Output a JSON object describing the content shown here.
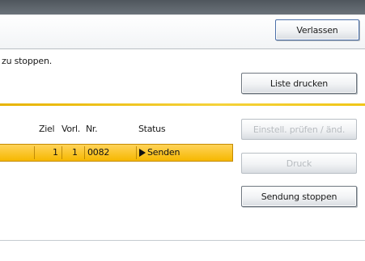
{
  "header": {
    "exit_label": "Verlassen"
  },
  "message": "zu stoppen.",
  "buttons": {
    "print_list": "Liste drucken",
    "edit": "Einstell. prüfen / änd.",
    "print": "Druck",
    "stop": "Sendung stoppen"
  },
  "table": {
    "headers": [
      "Ziel",
      "Vorl.",
      "Nr.",
      "Status"
    ],
    "rows": [
      {
        "ziel": "1",
        "vorl": "1",
        "nr": "0082",
        "status": "Senden",
        "status_icon": "play-icon"
      }
    ]
  },
  "colors": {
    "accent_gold": "#f0c617",
    "selected_row": "#ffd35a",
    "top_bar": "#4f565d"
  }
}
